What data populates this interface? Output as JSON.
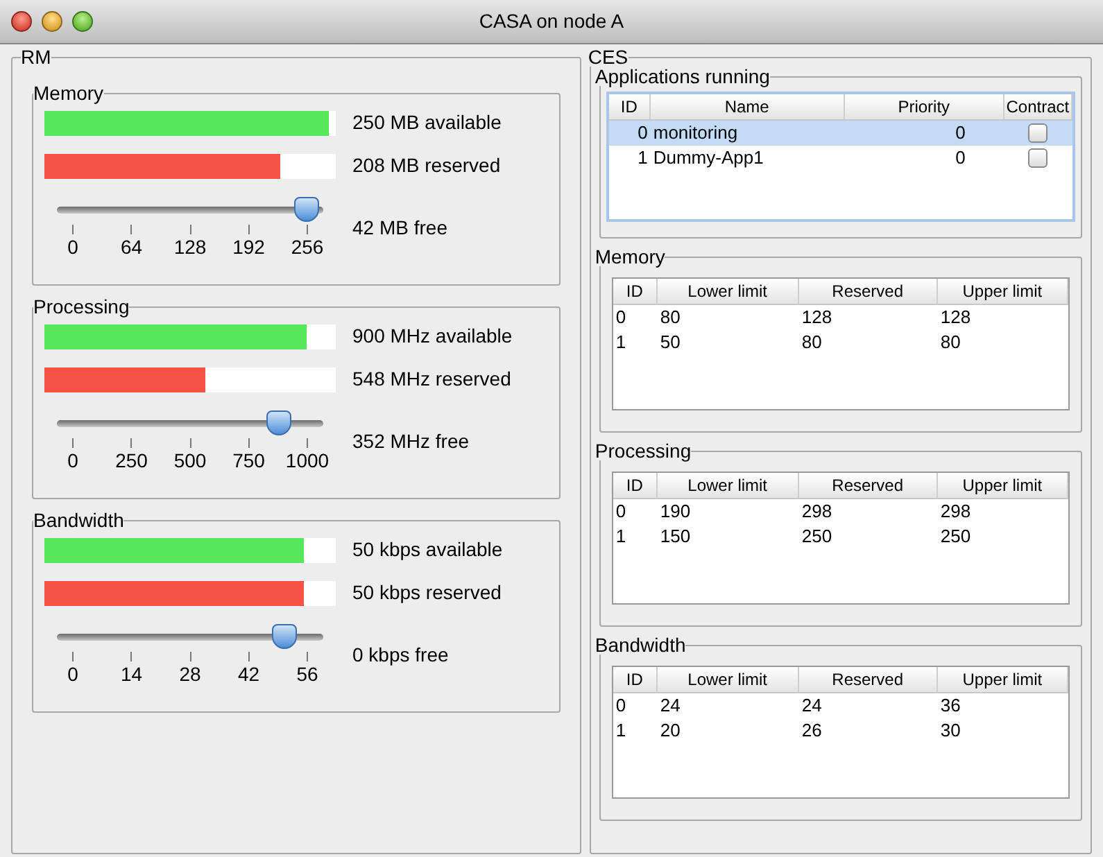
{
  "window": {
    "title": "CASA on node A"
  },
  "rm": {
    "title": "RM",
    "resources": [
      {
        "title": "Memory",
        "available": {
          "level": 0.976,
          "text": "250 MB available"
        },
        "reserved": {
          "level": 0.81,
          "text": "208 MB reserved"
        },
        "slider": {
          "level": 0.98,
          "ticks": [
            "0",
            "64",
            "128",
            "192",
            "256"
          ],
          "text": "42 MB free"
        }
      },
      {
        "title": "Processing",
        "available": {
          "level": 0.9,
          "text": "900 MHz available"
        },
        "reserved": {
          "level": 0.55,
          "text": "548 MHz reserved"
        },
        "slider": {
          "level": 0.87,
          "ticks": [
            "0",
            "250",
            "500",
            "750",
            "1000"
          ],
          "text": "352 MHz free"
        }
      },
      {
        "title": "Bandwidth",
        "available": {
          "level": 0.89,
          "text": "50 kbps available"
        },
        "reserved": {
          "level": 0.89,
          "text": "50 kbps reserved"
        },
        "slider": {
          "level": 0.89,
          "ticks": [
            "0",
            "14",
            "28",
            "42",
            "56"
          ],
          "text": "0 kbps free"
        }
      }
    ]
  },
  "ces": {
    "title": "CES",
    "applications": {
      "title": "Applications running",
      "columns": [
        "ID",
        "Name",
        "Priority",
        "Contract"
      ],
      "rows": [
        {
          "id": "0",
          "name": "monitoring",
          "priority": "0",
          "contract": false,
          "selected": true
        },
        {
          "id": "1",
          "name": "Dummy-App1",
          "priority": "0",
          "contract": false,
          "selected": false
        }
      ]
    },
    "tables": [
      {
        "title": "Memory",
        "columns": [
          "ID",
          "Lower limit",
          "Reserved",
          "Upper limit"
        ],
        "rows": [
          [
            "0",
            "80",
            "128",
            "128"
          ],
          [
            "1",
            "50",
            "80",
            "80"
          ]
        ]
      },
      {
        "title": "Processing",
        "columns": [
          "ID",
          "Lower limit",
          "Reserved",
          "Upper limit"
        ],
        "rows": [
          [
            "0",
            "190",
            "298",
            "298"
          ],
          [
            "1",
            "150",
            "250",
            "250"
          ]
        ]
      },
      {
        "title": "Bandwidth",
        "columns": [
          "ID",
          "Lower limit",
          "Reserved",
          "Upper limit"
        ],
        "rows": [
          [
            "0",
            "24",
            "24",
            "36"
          ],
          [
            "1",
            "20",
            "26",
            "30"
          ]
        ]
      }
    ]
  }
}
